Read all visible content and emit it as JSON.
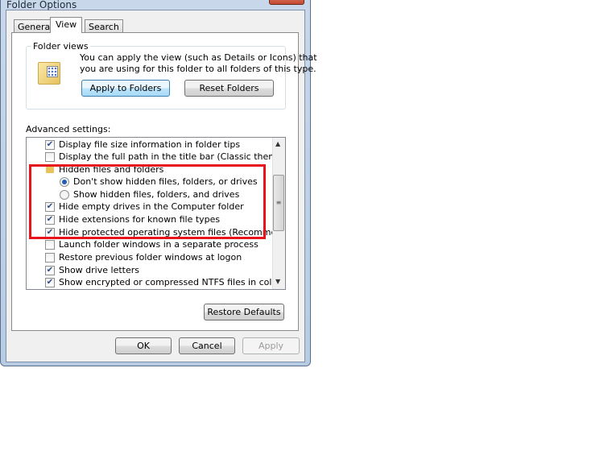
{
  "window": {
    "title": "Folder Options"
  },
  "tabs": [
    {
      "label": "General"
    },
    {
      "label": "View",
      "selected": true
    },
    {
      "label": "Search"
    }
  ],
  "folder_views": {
    "legend": "Folder views",
    "description_line1": "You can apply the view (such as Details or Icons) that",
    "description_line2": "you are using for this folder to all folders of this type.",
    "apply_label": "Apply to Folders",
    "reset_label": "Reset Folders"
  },
  "advanced": {
    "label": "Advanced settings:",
    "items": [
      {
        "type": "checkbox",
        "checked": true,
        "label": "Display file size information in folder tips"
      },
      {
        "type": "checkbox",
        "checked": false,
        "label": "Display the full path in the title bar (Classic theme only)"
      },
      {
        "type": "folder",
        "label": "Hidden files and folders"
      },
      {
        "type": "radio",
        "checked": true,
        "label": "Don't show hidden files, folders, or drives"
      },
      {
        "type": "radio",
        "checked": false,
        "label": "Show hidden files, folders, and drives"
      },
      {
        "type": "checkbox",
        "checked": true,
        "label": "Hide empty drives in the Computer folder"
      },
      {
        "type": "checkbox",
        "checked": true,
        "label": "Hide extensions for known file types"
      },
      {
        "type": "checkbox",
        "checked": true,
        "label": "Hide protected operating system files (Recommended)"
      },
      {
        "type": "checkbox",
        "checked": false,
        "label": "Launch folder windows in a separate process"
      },
      {
        "type": "checkbox",
        "checked": false,
        "label": "Restore previous folder windows at logon"
      },
      {
        "type": "checkbox",
        "checked": true,
        "label": "Show drive letters"
      },
      {
        "type": "checkbox",
        "checked": true,
        "label": "Show encrypted or compressed NTFS files in color"
      }
    ],
    "restore_label": "Restore Defaults"
  },
  "footer": {
    "ok_label": "OK",
    "cancel_label": "Cancel",
    "apply_label": "Apply"
  },
  "highlight_color": "#e8141c"
}
